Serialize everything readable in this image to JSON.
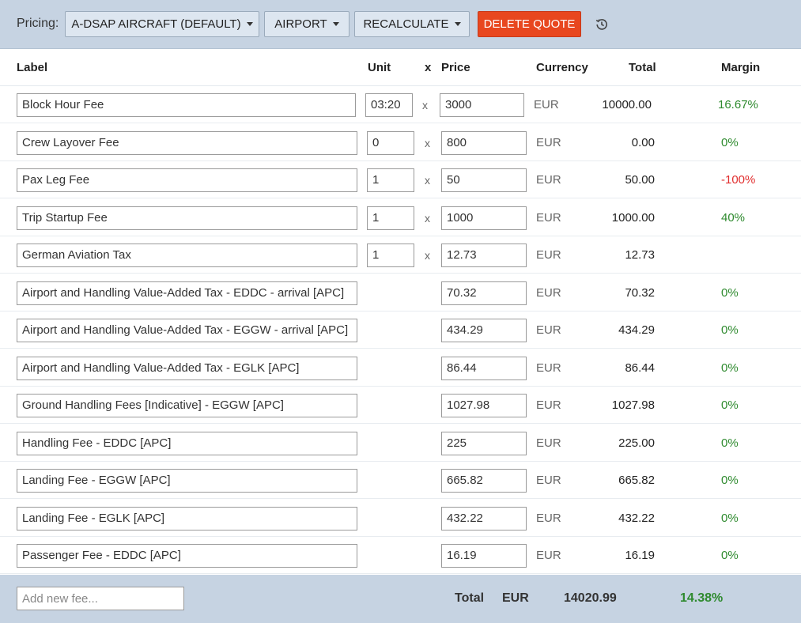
{
  "toolbar": {
    "pricing_label": "Pricing:",
    "aircraft_button": "A-DSAP AIRCRAFT (DEFAULT)",
    "airport_button": "AIRPORT",
    "recalculate_button": "RECALCULATE",
    "delete_button": "DELETE QUOTE",
    "history_icon": "history-icon"
  },
  "columns": {
    "label": "Label",
    "unit": "Unit",
    "x": "x",
    "price": "Price",
    "currency": "Currency",
    "total": "Total",
    "margin": "Margin"
  },
  "rows": [
    {
      "label": "Block Hour Fee",
      "unit": "03:20",
      "x": "x",
      "price": "3000",
      "currency": "EUR",
      "total": "10000.00",
      "margin": "16.67%",
      "margin_status": "positive"
    },
    {
      "label": "Crew Layover Fee",
      "unit": "0",
      "x": "x",
      "price": "800",
      "currency": "EUR",
      "total": "0.00",
      "margin": "0%",
      "margin_status": "positive"
    },
    {
      "label": "Pax Leg Fee",
      "unit": "1",
      "x": "x",
      "price": "50",
      "currency": "EUR",
      "total": "50.00",
      "margin": "-100%",
      "margin_status": "negative"
    },
    {
      "label": "Trip Startup Fee",
      "unit": "1",
      "x": "x",
      "price": "1000",
      "currency": "EUR",
      "total": "1000.00",
      "margin": "40%",
      "margin_status": "positive"
    },
    {
      "label": "German Aviation Tax",
      "unit": "1",
      "x": "x",
      "price": "12.73",
      "currency": "EUR",
      "total": "12.73",
      "margin": "",
      "margin_status": "none"
    },
    {
      "label": "Airport and Handling Value-Added Tax  -  EDDC - arrival [APC]",
      "unit": null,
      "x": null,
      "price": "70.32",
      "currency": "EUR",
      "total": "70.32",
      "margin": "0%",
      "margin_status": "positive"
    },
    {
      "label": "Airport and Handling Value-Added Tax  -  EGGW - arrival [APC]",
      "unit": null,
      "x": null,
      "price": "434.29",
      "currency": "EUR",
      "total": "434.29",
      "margin": "0%",
      "margin_status": "positive"
    },
    {
      "label": "Airport and Handling Value-Added Tax  -  EGLK [APC]",
      "unit": null,
      "x": null,
      "price": "86.44",
      "currency": "EUR",
      "total": "86.44",
      "margin": "0%",
      "margin_status": "positive"
    },
    {
      "label": "Ground Handling Fees [Indicative]  -  EGGW [APC]",
      "unit": null,
      "x": null,
      "price": "1027.98",
      "currency": "EUR",
      "total": "1027.98",
      "margin": "0%",
      "margin_status": "positive"
    },
    {
      "label": "Handling Fee  -  EDDC [APC]",
      "unit": null,
      "x": null,
      "price": "225",
      "currency": "EUR",
      "total": "225.00",
      "margin": "0%",
      "margin_status": "positive"
    },
    {
      "label": "Landing Fee  -  EGGW [APC]",
      "unit": null,
      "x": null,
      "price": "665.82",
      "currency": "EUR",
      "total": "665.82",
      "margin": "0%",
      "margin_status": "positive"
    },
    {
      "label": "Landing Fee  -  EGLK [APC]",
      "unit": null,
      "x": null,
      "price": "432.22",
      "currency": "EUR",
      "total": "432.22",
      "margin": "0%",
      "margin_status": "positive"
    },
    {
      "label": "Passenger Fee  -  EDDC [APC]",
      "unit": null,
      "x": null,
      "price": "16.19",
      "currency": "EUR",
      "total": "16.19",
      "margin": "0%",
      "margin_status": "positive"
    }
  ],
  "footer": {
    "add_placeholder": "Add new fee...",
    "total_label": "Total",
    "currency": "EUR",
    "total_value": "14020.99",
    "margin": "14.38%"
  },
  "colors": {
    "toolbar_bg": "#c6d3e2",
    "danger": "#e8471f",
    "positive": "#2e8a2e",
    "negative": "#e12f2f"
  }
}
